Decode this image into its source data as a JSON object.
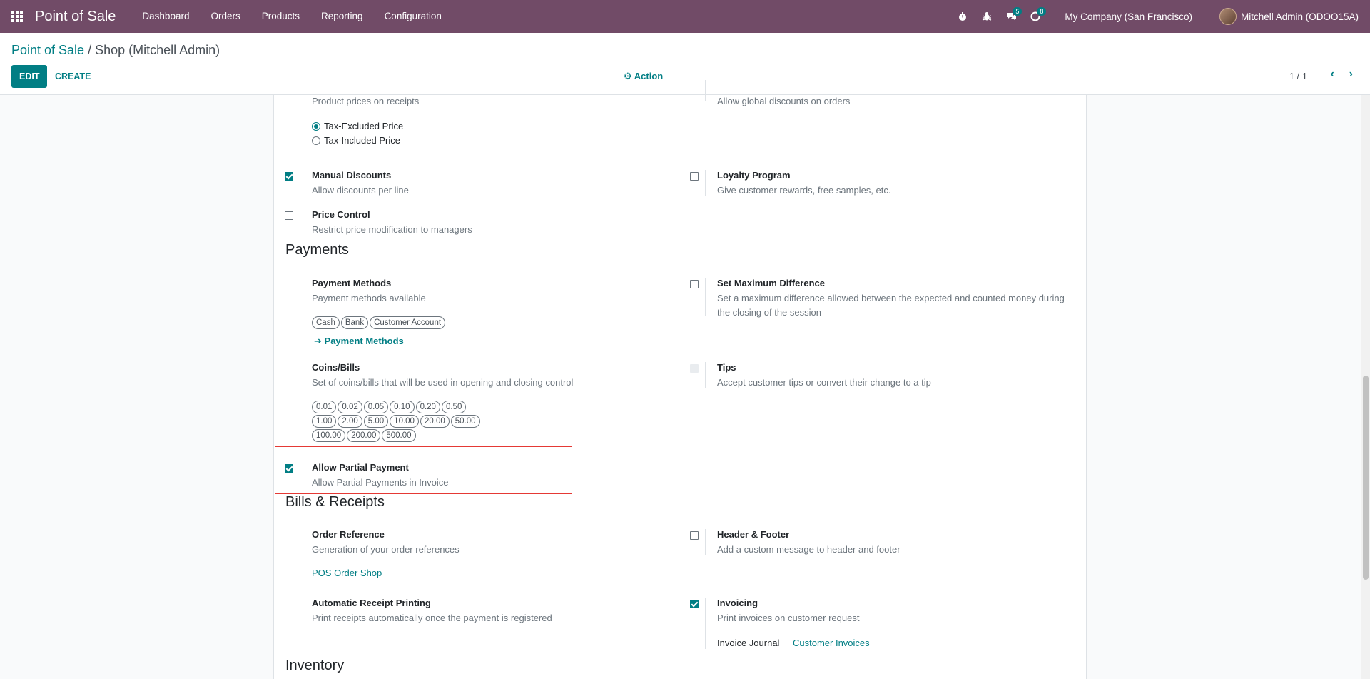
{
  "navbar": {
    "brand": "Point of Sale",
    "menu": [
      "Dashboard",
      "Orders",
      "Products",
      "Reporting",
      "Configuration"
    ],
    "icons": [
      "stopwatch-icon",
      "bug-icon",
      "chat-icon",
      "activity-icon"
    ],
    "chat_badge": "5",
    "activity_badge": "8",
    "company": "My Company (San Francisco)",
    "user": "Mitchell Admin (ODOO15A)"
  },
  "control_panel": {
    "breadcrumb_root": "Point of Sale",
    "breadcrumb_sep": " / ",
    "breadcrumb_current": "Shop (Mitchell Admin)",
    "edit_label": "EDIT",
    "create_label": "CREATE",
    "action_label": "Action",
    "pager": "1 / 1"
  },
  "settings": {
    "product_prices_desc": "Product prices on receipts",
    "radio_tax_excluded": "Tax-Excluded Price",
    "radio_tax_included": "Tax-Included Price",
    "global_discounts_desc": "Allow global discounts on orders",
    "manual_discounts": {
      "title": "Manual Discounts",
      "desc": "Allow discounts per line"
    },
    "loyalty_program": {
      "title": "Loyalty Program",
      "desc": "Give customer rewards, free samples, etc."
    },
    "price_control": {
      "title": "Price Control",
      "desc": "Restrict price modification to managers"
    },
    "payments_section": "Payments",
    "payment_methods": {
      "title": "Payment Methods",
      "desc": "Payment methods available",
      "tags": [
        "Cash",
        "Bank",
        "Customer Account"
      ],
      "link": "Payment Methods"
    },
    "set_max_difference": {
      "title": "Set Maximum Difference",
      "desc": "Set a maximum difference allowed between the expected and counted money during the closing of the session"
    },
    "coins_bills": {
      "title": "Coins/Bills",
      "desc": "Set of coins/bills that will be used in opening and closing control",
      "tags": [
        "0.01",
        "0.02",
        "0.05",
        "0.10",
        "0.20",
        "0.50",
        "1.00",
        "2.00",
        "5.00",
        "10.00",
        "20.00",
        "50.00",
        "100.00",
        "200.00",
        "500.00"
      ]
    },
    "tips": {
      "title": "Tips",
      "desc": "Accept customer tips or convert their change to a tip"
    },
    "allow_partial_payment": {
      "title": "Allow Partial Payment",
      "desc": "Allow Partial Payments in Invoice"
    },
    "bills_section": "Bills & Receipts",
    "order_reference": {
      "title": "Order Reference",
      "desc": "Generation of your order references",
      "link": "POS Order Shop"
    },
    "header_footer": {
      "title": "Header & Footer",
      "desc": "Add a custom message to header and footer"
    },
    "auto_receipt": {
      "title": "Automatic Receipt Printing",
      "desc": "Print receipts automatically once the payment is registered"
    },
    "invoicing": {
      "title": "Invoicing",
      "desc": "Print invoices on customer request",
      "journal_label": "Invoice Journal",
      "journal_value": "Customer Invoices"
    },
    "inventory_section": "Inventory"
  }
}
